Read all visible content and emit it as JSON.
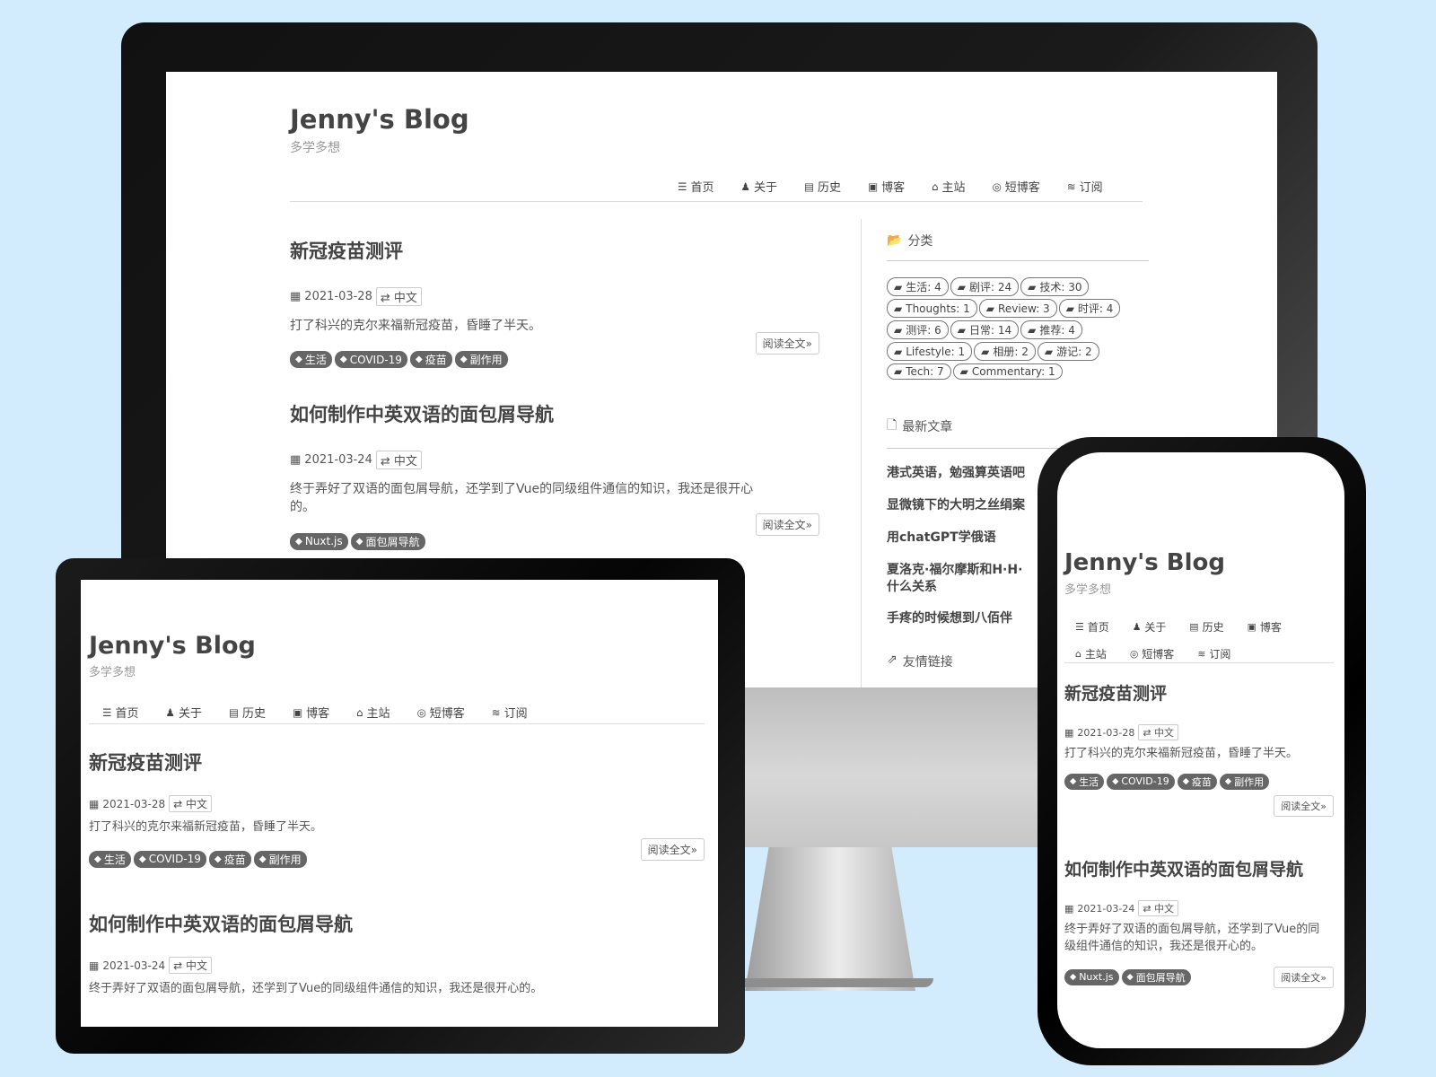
{
  "blog": {
    "title": "Jenny's Blog",
    "subtitle": "多学多想"
  },
  "nav": [
    {
      "label": "首页",
      "icon": "list-icon",
      "glyph": "☰"
    },
    {
      "label": "关于",
      "icon": "user-icon",
      "glyph": "♟"
    },
    {
      "label": "历史",
      "icon": "book-icon",
      "glyph": "▤"
    },
    {
      "label": "博客",
      "icon": "archive-icon",
      "glyph": "▣"
    },
    {
      "label": "主站",
      "icon": "home-icon",
      "glyph": "⌂"
    },
    {
      "label": "短博客",
      "icon": "weibo-icon",
      "glyph": "◎"
    },
    {
      "label": "订阅",
      "icon": "rss-icon",
      "glyph": "≋"
    }
  ],
  "posts": [
    {
      "title": "新冠疫苗测评",
      "date": "2021-03-28",
      "lang": "中文",
      "excerpt": "打了科兴的克尔来福新冠疫苗，昏睡了半天。",
      "tags": [
        "生活",
        "COVID-19",
        "疫苗",
        "副作用"
      ]
    },
    {
      "title": "如何制作中英双语的面包屑导航",
      "date": "2021-03-24",
      "lang": "中文",
      "excerpt_desktop_1": "终于弄好了双语的面包屑导航，还学到了Vue的同级组件通信的知识，我还是很开心",
      "excerpt_desktop_2": "的。",
      "excerpt_tablet": "终于弄好了双语的面包屑导航，还学到了Vue的同级组件通信的知识，我还是很开心的。",
      "excerpt_phone_1": "终于弄好了双语的面包屑导航，还学到了Vue的同",
      "excerpt_phone_2": "级组件通信的知识，我还是很开心的。",
      "tags": [
        "Nuxt.js",
        "面包屑导航"
      ]
    }
  ],
  "readmore": "阅读全文»",
  "sidebar": {
    "categories_title": "分类",
    "categories": [
      "生活: 4",
      "剧评: 24",
      "技术: 30",
      "Thoughts: 1",
      "Review: 3",
      "时评: 4",
      "测评: 6",
      "日常: 14",
      "推荐: 4",
      "Lifestyle: 1",
      "相册: 2",
      "游记: 2",
      "Tech: 7",
      "Commentary: 1"
    ],
    "latest_title": "最新文章",
    "latest": [
      "港式英语，勉强算英语吧",
      "显微镜下的大明之丝绢案",
      "用chatGPT学俄语",
      "夏洛克·福尔摩斯和H·H·",
      "什么关系",
      "手疼的时候想到八佰伴"
    ],
    "links_title": "友情链接"
  },
  "colors": {
    "background": "#d3ecfd",
    "tag_bg": "#666666",
    "text": "#444444"
  }
}
